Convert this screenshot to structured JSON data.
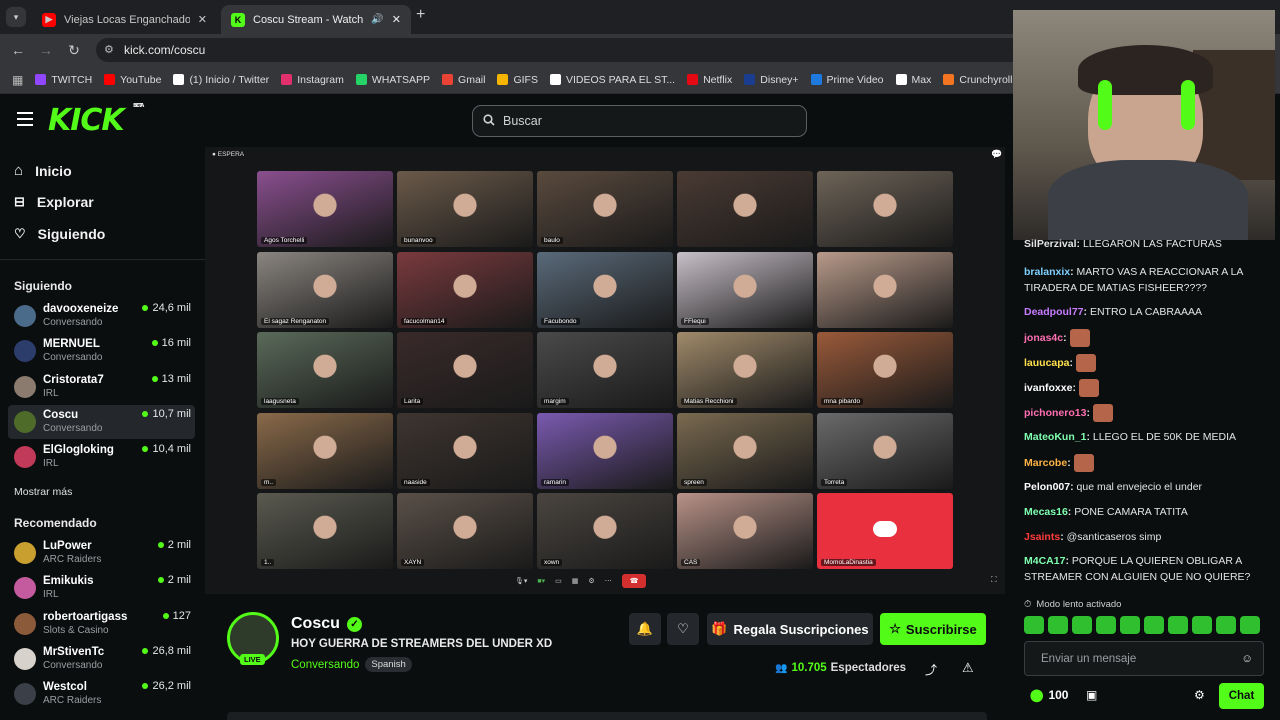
{
  "browser": {
    "tabs": [
      {
        "title": "Viejas Locas Enganchados Parte",
        "favicon_color": "#ff0000"
      },
      {
        "title": "Coscu Stream - Watch Live",
        "favicon_color": "#53fc18"
      }
    ],
    "url": "kick.com/coscu",
    "bookmarks": [
      {
        "label": "TWITCH",
        "color": "#9146ff"
      },
      {
        "label": "YouTube",
        "color": "#ff0000"
      },
      {
        "label": "(1) Inicio / Twitter",
        "color": "#ffffff"
      },
      {
        "label": "Instagram",
        "color": "#e1306c"
      },
      {
        "label": "WHATSAPP",
        "color": "#25d366"
      },
      {
        "label": "Gmail",
        "color": "#ea4335"
      },
      {
        "label": "GIFS",
        "color": "#f4b400"
      },
      {
        "label": "VIDEOS PARA EL ST...",
        "color": "#ffffff"
      },
      {
        "label": "Netflix",
        "color": "#e50914"
      },
      {
        "label": "Disney+",
        "color": "#1a3d8f"
      },
      {
        "label": "Prime Video",
        "color": "#1f7ae0"
      },
      {
        "label": "Max",
        "color": "#ffffff"
      },
      {
        "label": "Crunchyroll",
        "color": "#f47521"
      }
    ]
  },
  "header": {
    "logo": "KICK",
    "logo_badge": "BETA",
    "search_placeholder": "Buscar"
  },
  "sidebar": {
    "nav": [
      {
        "label": "Inicio",
        "icon": "home-icon"
      },
      {
        "label": "Explorar",
        "icon": "compass-icon"
      },
      {
        "label": "Siguiendo",
        "icon": "heart-icon"
      }
    ],
    "following_title": "Siguiendo",
    "following": [
      {
        "name": "davooxeneize",
        "sub": "Conversando",
        "viewers": "24,6 mil",
        "color": "#4a6b8a"
      },
      {
        "name": "MERNUEL",
        "sub": "Conversando",
        "viewers": "16 mil",
        "color": "#2c3c6b"
      },
      {
        "name": "Cristorata7",
        "sub": "IRL",
        "viewers": "13 mil",
        "color": "#8a7b6e"
      },
      {
        "name": "Coscu",
        "sub": "Conversando",
        "viewers": "10,7 mil",
        "color": "#4f6b2a"
      },
      {
        "name": "ElGlogloking",
        "sub": "IRL",
        "viewers": "10,4 mil",
        "color": "#c23a5a"
      }
    ],
    "show_more": "Mostrar más",
    "recommended_title": "Recomendado",
    "recommended": [
      {
        "name": "LuPower",
        "sub": "ARC Raiders",
        "viewers": "2 mil",
        "color": "#c9a030"
      },
      {
        "name": "Emikukis",
        "sub": "IRL",
        "viewers": "2 mil",
        "color": "#c45b9e"
      },
      {
        "name": "robertoartigass",
        "sub": "Slots & Casino",
        "viewers": "127",
        "color": "#8a5a3a"
      },
      {
        "name": "MrStivenTc",
        "sub": "Conversando",
        "viewers": "26,8 mil",
        "color": "#d8d2cc"
      },
      {
        "name": "Westcol",
        "sub": "ARC Raiders",
        "viewers": "26,2 mil",
        "color": "#3a3f48"
      }
    ]
  },
  "player": {
    "top_label": "ESPERA",
    "tiles": [
      "Agos Torchelli",
      "bunanvoo",
      "baulo",
      "",
      "",
      "El sagaz Renganaton",
      "facucolman14",
      "Facubondo",
      "FFlequi",
      "",
      "laagusneta",
      "Larita",
      "margim",
      "Matias Recchioni",
      "mna pibardo",
      "m..",
      "naaside",
      "ramarin",
      "spreen",
      "Torreta",
      "1..",
      "XAYN",
      "xown",
      "CAS",
      "MomoLaDinastia"
    ],
    "tile_colors": [
      "#8a4f8f",
      "#6b5a4a",
      "#5a4a3e",
      "#4a3a33",
      "#6e6458",
      "#8a8580",
      "#7a3a3e",
      "#5a6a7a",
      "#c8c0c8",
      "#b89a8a",
      "#5a6a5a",
      "#3a2a2a",
      "#4a4a4a",
      "#a08a6a",
      "#9a5a3a",
      "#8a6a4a",
      "#3e3530",
      "#7a5ab0",
      "#7a6a50",
      "#6a6a6a",
      "#5a5a50",
      "#5a5048",
      "#4a4540",
      "#b89288",
      "#e8303e"
    ]
  },
  "stream": {
    "channel": "Coscu",
    "title": "HOY GUERRA DE STREAMERS DEL UNDER XD",
    "category": "Conversando",
    "language": "Spanish",
    "live": "LIVE",
    "gift_label": "Regala Suscripciones",
    "subscribe_label": "Suscribirse",
    "viewers_count": "10.705",
    "viewers_label": "Espectadores"
  },
  "chat": {
    "messages": [
      {
        "user": "SilPerzival",
        "text": "LLEGARON LAS FACTURAS",
        "color": "#e4e4e4"
      },
      {
        "user": "bralanxix",
        "text": "MARTO VAS A REACCIONAR A LA TIRADERA DE MATIAS FISHEER????",
        "color": "#7fd0ff"
      },
      {
        "user": "Deadpoul77",
        "text": "ENTRO LA CABRAAAA",
        "color": "#c77dff"
      },
      {
        "user": "jonas4c",
        "text": "",
        "color": "#ff6fb1"
      },
      {
        "user": "lauucapa",
        "text": "",
        "color": "#ffe14d"
      },
      {
        "user": "ivanfoxxe",
        "text": "",
        "color": "#ffffff"
      },
      {
        "user": "pichonero13",
        "text": "",
        "color": "#ff6fb1"
      },
      {
        "user": "MateoKun_1",
        "text": "LLEGO EL DE 50K DE MEDIA",
        "color": "#7fffb0"
      },
      {
        "user": "Marcobe",
        "text": "",
        "color": "#ffb347"
      },
      {
        "user": "Pelon007",
        "text": "que mal envejecio el under",
        "color": "#ffffff"
      },
      {
        "user": "Mecas16",
        "text": "PONE CAMARA TATITA",
        "color": "#7fffb0"
      },
      {
        "user": "Jsaints",
        "text": "@santicaseros simp",
        "color": "#ff3b3b"
      },
      {
        "user": "M4CA17",
        "text": "PORQUE LA QUIEREN OBLIGAR A STREAMER CON ALGUIEN QUE NO QUIERE?",
        "color": "#7fffb0"
      }
    ],
    "slow_mode": "Modo lento activado",
    "input_placeholder": "Enviar un mensaje",
    "points": "100",
    "chat_button": "Chat"
  }
}
